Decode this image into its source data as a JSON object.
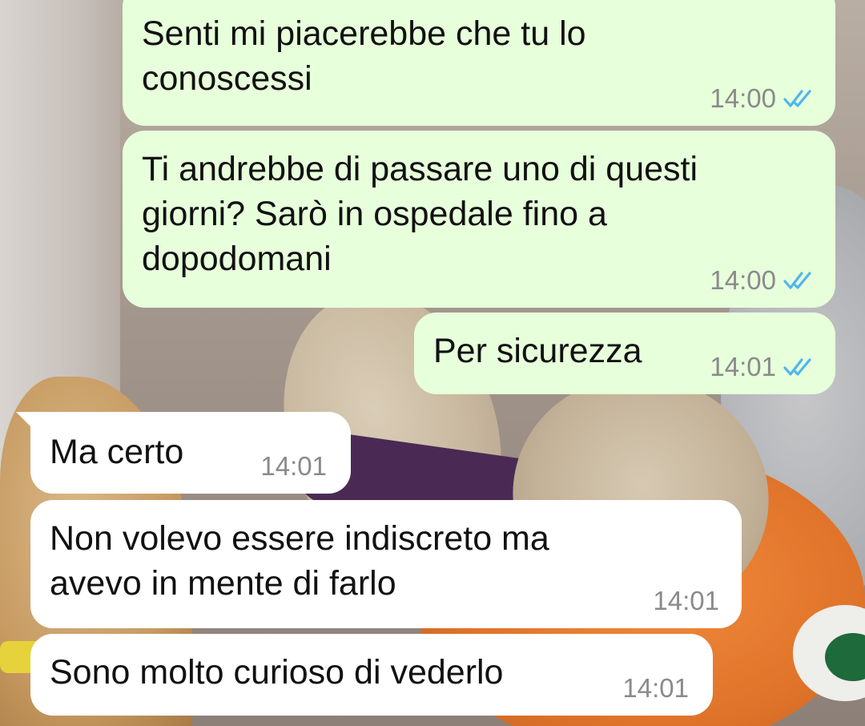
{
  "messages": [
    {
      "direction": "outgoing",
      "lines": [
        "Senti mi piacerebbe che tu lo",
        "conoscessi"
      ],
      "time": "14:00",
      "read_receipt": "double-check-read"
    },
    {
      "direction": "outgoing",
      "lines": [
        "Ti andrebbe di passare uno di questi",
        "giorni? Sarò in ospedale fino a",
        "dopodomani"
      ],
      "time": "14:00",
      "read_receipt": "double-check-read"
    },
    {
      "direction": "outgoing",
      "lines": [
        "Per sicurezza"
      ],
      "time": "14:01",
      "read_receipt": "double-check-read"
    },
    {
      "direction": "incoming",
      "lines": [
        "Ma certo"
      ],
      "time": "14:01"
    },
    {
      "direction": "incoming",
      "lines": [
        "Non volevo essere indiscreto ma",
        "avevo in mente di farlo"
      ],
      "time": "14:01"
    },
    {
      "direction": "incoming",
      "lines": [
        "Sono molto curioso di vederlo"
      ],
      "time": "14:01"
    }
  ],
  "colors": {
    "outgoing_bubble": "#e7ffdb",
    "incoming_bubble": "#ffffff",
    "read_tick": "#4fb6ec",
    "timestamp": "#8a8a8a"
  },
  "icons": {
    "read_receipt": "double-check-icon"
  }
}
